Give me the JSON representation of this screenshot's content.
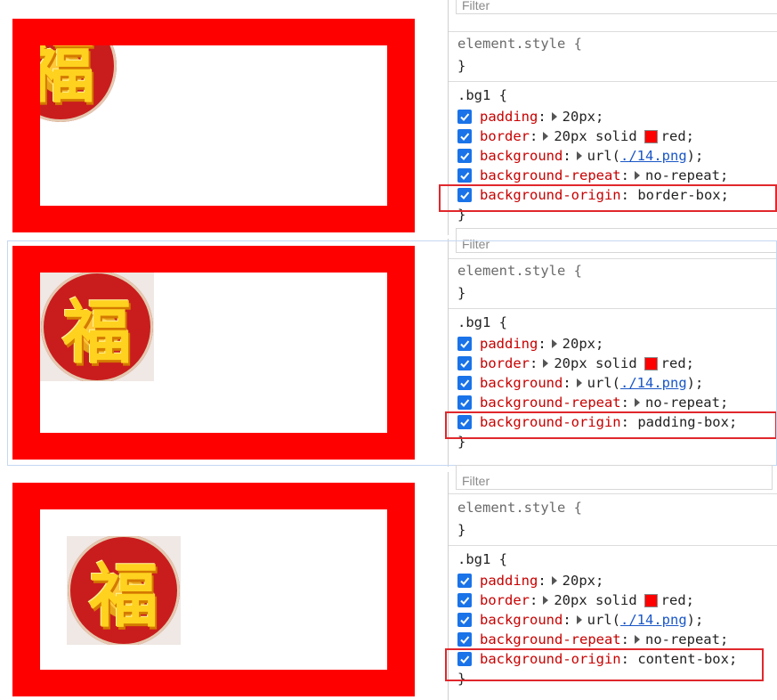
{
  "colors": {
    "border_red": "#ff0000",
    "checkbox_blue": "#1a73e8",
    "highlight": "#e0282c",
    "prop_name": "#c80000"
  },
  "image_glyph": "福",
  "panels": [
    {
      "filter_placeholder": "Filter",
      "element_style": {
        "open": "element.style {",
        "close": "}"
      },
      "rule": {
        "selector_open": ".bg1 {",
        "padding_name": "padding",
        "padding_value": "20px",
        "border_name": "border",
        "border_value_pre": "20px solid",
        "border_color": "red",
        "background_name": "background",
        "bg_url_pre": "url(",
        "bg_url_link": "./14.png",
        "bg_url_post": ");",
        "repeat_name": "background-repeat",
        "repeat_value": "no-repeat",
        "origin_name": "background-origin",
        "origin_value": "border-box",
        "close": "}"
      }
    },
    {
      "filter_placeholder": "Filter",
      "element_style": {
        "open": "element.style {",
        "close": "}"
      },
      "rule": {
        "selector_open": ".bg1 {",
        "padding_name": "padding",
        "padding_value": "20px",
        "border_name": "border",
        "border_value_pre": "20px solid",
        "border_color": "red",
        "background_name": "background",
        "bg_url_pre": "url(",
        "bg_url_link": "./14.png",
        "bg_url_post": ");",
        "repeat_name": "background-repeat",
        "repeat_value": "no-repeat",
        "origin_name": "background-origin",
        "origin_value": "padding-box",
        "close": "}"
      }
    },
    {
      "filter_placeholder": "Filter",
      "element_style": {
        "open": "element.style {",
        "close": "}"
      },
      "rule": {
        "selector_open": ".bg1 {",
        "padding_name": "padding",
        "padding_value": "20px",
        "border_name": "border",
        "border_value_pre": "20px solid",
        "border_color": "red",
        "background_name": "background",
        "bg_url_pre": "url(",
        "bg_url_link": "./14.png",
        "bg_url_post": ");",
        "repeat_name": "background-repeat",
        "repeat_value": "no-repeat",
        "origin_name": "background-origin",
        "origin_value": "content-box",
        "close": "}"
      }
    }
  ]
}
